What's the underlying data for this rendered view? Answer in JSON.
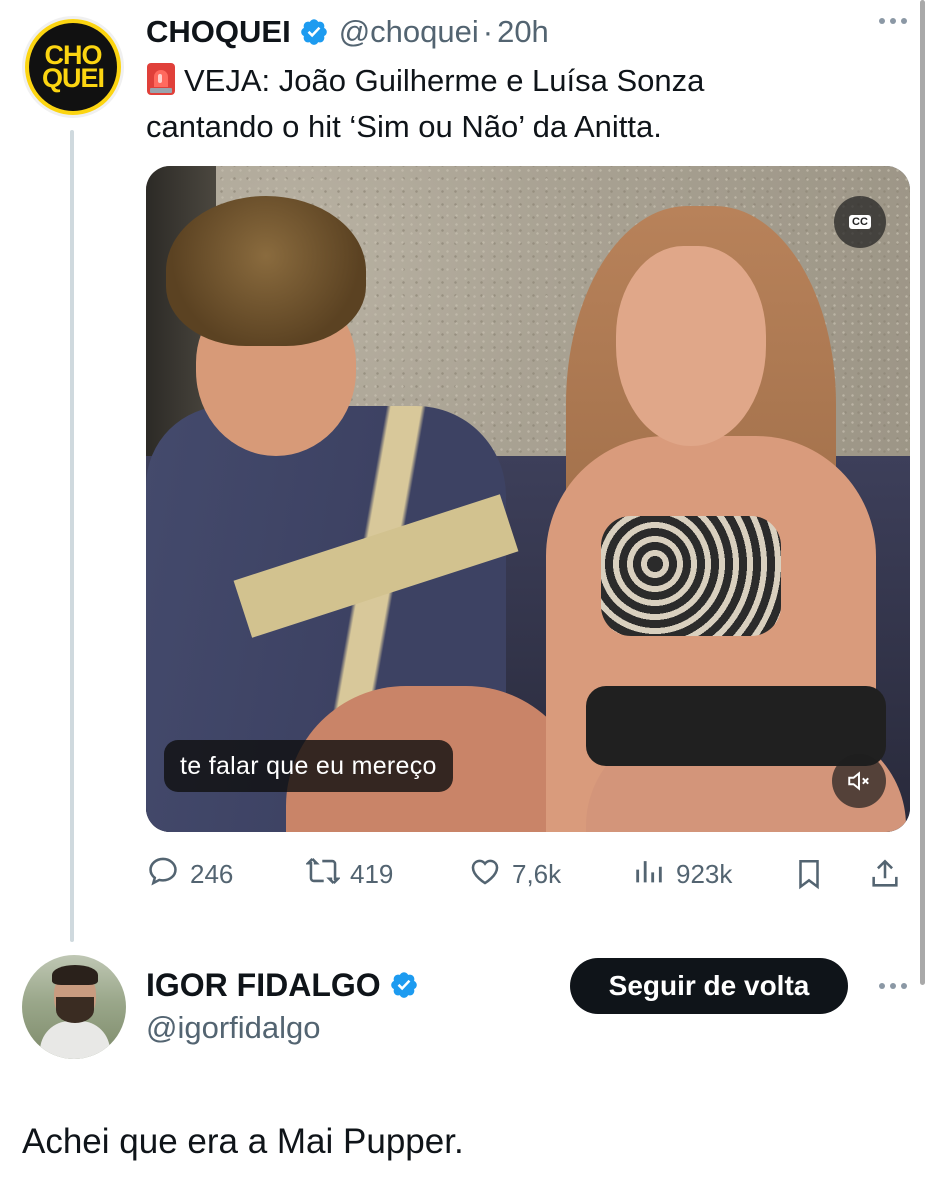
{
  "tweet": {
    "author_name": "CHOQUEI",
    "author_handle": "@choquei",
    "separator": "·",
    "time": "20h",
    "avatar_text_top": "CHO",
    "avatar_text_bottom": "QUEI",
    "text_line1": "VEJA: João Guilherme e Luísa Sonza",
    "text_line2": "cantando o hit ‘Sim ou Não’ da Anitta.",
    "media": {
      "caption": "te falar que eu mereço",
      "cc_label": "CC"
    },
    "stats": {
      "replies": "246",
      "retweets": "419",
      "likes": "7,6k",
      "views": "923k"
    }
  },
  "reply": {
    "author_name": "IGOR FIDALGO",
    "author_handle": "@igorfidalgo",
    "follow_label": "Seguir de volta",
    "text": "Achei que era a Mai Pupper."
  },
  "colors": {
    "verified": "#1d9bf0",
    "muted_text": "#536471",
    "primary_text": "#0f1419",
    "brand_yellow": "#fcd511"
  },
  "icons": [
    "verified-icon",
    "siren-icon",
    "more-icon",
    "cc-icon",
    "mute-icon",
    "reply-icon",
    "retweet-icon",
    "like-icon",
    "views-icon",
    "bookmark-icon",
    "share-icon"
  ]
}
